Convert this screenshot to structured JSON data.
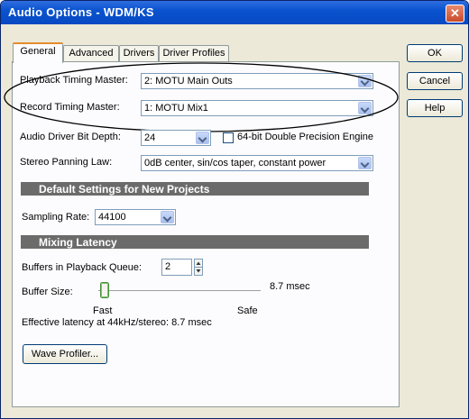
{
  "window": {
    "title": "Audio Options - WDM/KS",
    "close_glyph": "✕"
  },
  "tabs": [
    {
      "label": "General"
    },
    {
      "label": "Advanced"
    },
    {
      "label": "Drivers"
    },
    {
      "label": "Driver Profiles"
    }
  ],
  "buttons": {
    "ok": "OK",
    "cancel": "Cancel",
    "help": "Help",
    "wave_profiler": "Wave Profiler..."
  },
  "general": {
    "playback_timing_master": {
      "label": "Playback Timing Master:",
      "value": "2: MOTU Main Outs"
    },
    "record_timing_master": {
      "label": "Record Timing Master:",
      "value": "1: MOTU Mix1"
    },
    "bit_depth": {
      "label": "Audio Driver Bit Depth:",
      "value": "24"
    },
    "double_precision": {
      "label": "64-bit Double Precision Engine",
      "checked": false
    },
    "stereo_panning": {
      "label": "Stereo Panning Law:",
      "value": "0dB center, sin/cos taper, constant power"
    }
  },
  "default_settings": {
    "header": "Default Settings for New Projects",
    "sampling_rate": {
      "label": "Sampling Rate:",
      "value": "44100"
    }
  },
  "mixing_latency": {
    "header": "Mixing Latency",
    "buffers_queue": {
      "label": "Buffers in Playback Queue:",
      "value": "2"
    },
    "buffer_size": {
      "label": "Buffer Size:",
      "value": "8.7 msec",
      "fast_label": "Fast",
      "safe_label": "Safe",
      "slider_fraction": 0.0
    },
    "effective_latency": "Effective latency at 44kHz/stereo:  8.7 msec"
  }
}
